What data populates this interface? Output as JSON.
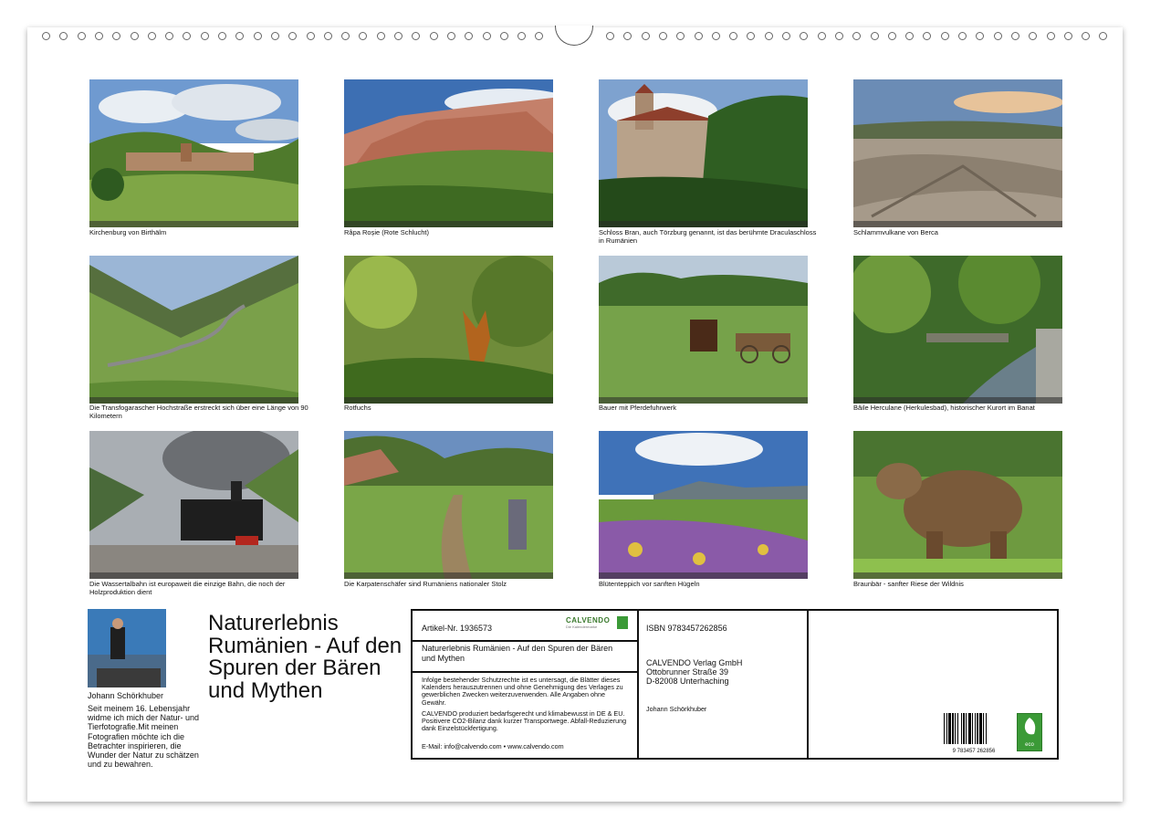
{
  "captions": [
    "Kirchenburg von Birthälm",
    "Râpa Roșie (Rote Schlucht)",
    "Schloss Bran, auch Törzburg genannt, ist das berühmte Draculaschloss in Rumänien",
    "Schlammvulkane von Berca",
    "Die Transfogarascher Hochstraße erstreckt sich über eine Länge von 90 Kilometern",
    "Rotfuchs",
    "Bauer mit Pferdefuhrwerk",
    "Băile Herculane (Herkulesbad), historischer Kurort im Banat",
    "Die Wassertalbahn ist europaweit die einzige Bahn, die noch der Holzproduktion dient",
    "Die Karpatenschäfer sind Rumäniens nationaler Stolz",
    "Blütenteppich vor sanften Hügeln",
    "Braunbär - sanfter Riese der Wildnis"
  ],
  "author": {
    "name": "Johann Schörkhuber",
    "bio": "Seit meinem 16. Lebensjahr widme ich mich der Natur- und Tierfotografie.Mit meinen Fotografien möchte ich die Betrachter inspirieren, die Wunder der Natur zu schätzen und zu bewahren."
  },
  "title": "Naturerlebnis Rumänien - Auf den Spuren der Bären und Mythen",
  "info": {
    "article": "Artikel-Nr. 1936573",
    "logo_text": "CALVENDO",
    "logo_sub": "Die Kalendermarke",
    "product_title": "Naturerlebnis Rumänien - Auf den Spuren der Bären und Mythen",
    "legal1": "Infolge bestehender Schutzrechte ist es untersagt, die Blätter dieses Kalenders herauszutrennen und ohne Genehmigung des Verlages zu gewerblichen Zwecken weiterzuverwenden. Alle Angaben ohne Gewähr.",
    "legal2": "CALVENDO produziert bedarfsgerecht und klimabewusst in DE & EU. Positivere CO2-Bilanz dank kurzer Transportwege. Abfall-Reduzierung dank Einzelstückfertigung.",
    "contact": "E-Mail: info@calvendo.com • www.calvendo.com",
    "isbn": "ISBN 9783457262856",
    "publisher_name": "CALVENDO Verlag GmbH",
    "publisher_street": "Ottobrunner Straße 39",
    "publisher_city": "D-82008 Unterhaching",
    "photographer": "Johann Schörkhuber",
    "barcode_digits": "9 783457 262856",
    "eco_label": "eco"
  },
  "colors": {
    "brand_green": "#3b9a37",
    "frame": "#111111"
  }
}
